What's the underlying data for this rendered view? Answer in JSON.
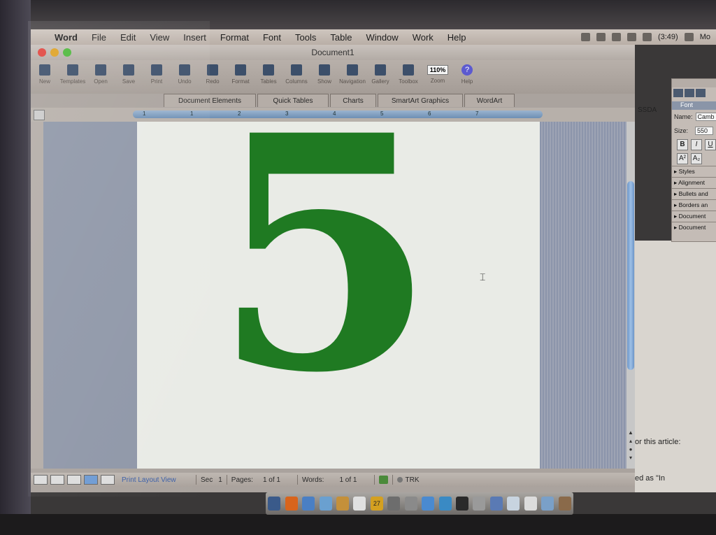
{
  "menubar": {
    "items": [
      "Word",
      "File",
      "Edit",
      "View",
      "Insert",
      "Format",
      "Font",
      "Tools",
      "Table",
      "Window",
      "Work",
      "Help"
    ],
    "clock": "(3:49)",
    "user": "Mo"
  },
  "window": {
    "title": "Document1",
    "traffic_colors": [
      "#e0443e",
      "#dea123",
      "#4db83b"
    ]
  },
  "toolbar": {
    "buttons": [
      {
        "label": "New",
        "icon": "new-doc-icon"
      },
      {
        "label": "Templates",
        "icon": "templates-icon"
      },
      {
        "label": "Open",
        "icon": "open-icon"
      },
      {
        "label": "Save",
        "icon": "save-icon"
      },
      {
        "label": "Print",
        "icon": "print-icon"
      },
      {
        "label": "Undo",
        "icon": "undo-icon"
      },
      {
        "label": "Redo",
        "icon": "redo-icon"
      },
      {
        "label": "Format",
        "icon": "format-brush-icon"
      },
      {
        "label": "Tables",
        "icon": "tables-icon"
      },
      {
        "label": "Columns",
        "icon": "columns-icon"
      },
      {
        "label": "Show",
        "icon": "show-icon"
      },
      {
        "label": "Navigation",
        "icon": "navigation-icon"
      },
      {
        "label": "Gallery",
        "icon": "gallery-icon"
      },
      {
        "label": "Toolbox",
        "icon": "toolbox-icon"
      }
    ],
    "zoom_value": "110%",
    "zoom_label": "Zoom",
    "help_label": "Help"
  },
  "ribbon": {
    "tabs": [
      "Document Elements",
      "Quick Tables",
      "Charts",
      "SmartArt Graphics",
      "WordArt"
    ]
  },
  "ruler": {
    "numbers": [
      "1",
      "1",
      "2",
      "3",
      "4",
      "5",
      "6",
      "7"
    ]
  },
  "page": {
    "content": "5",
    "text_color": "#1f7a22"
  },
  "statusbar": {
    "view": "Print Layout View",
    "sec_label": "Sec",
    "sec_value": "1",
    "pages_label": "Pages:",
    "pages_value": "1 of 1",
    "words_label": "Words:",
    "words_value": "1 of 1",
    "trk": "TRK"
  },
  "palette": {
    "section": "Font",
    "name_label": "Name:",
    "name_value": "Camb",
    "size_label": "Size:",
    "size_value": "550",
    "bold": "B",
    "italic": "I",
    "underline": "U",
    "superscript": "A²",
    "subscript": "A₂",
    "sections": [
      "Styles",
      "Alignment",
      "Bullets and",
      "Borders an",
      "Document",
      "Document"
    ]
  },
  "background_doc": {
    "tag": "SSDA",
    "line1": "or this article:",
    "line2": "ed as \"In"
  },
  "dock": {
    "calendar_day": "27"
  }
}
